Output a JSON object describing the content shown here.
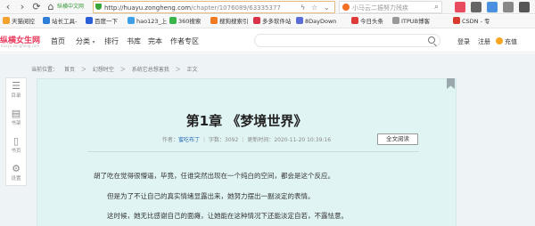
{
  "browser": {
    "bookmark_corner": "纵横中文网",
    "url_host": "http://huayu.zongheng.com",
    "url_path": "/chapter/1076089/63335377",
    "search_placeholder": "小马云二振努力残疾",
    "bookmarks": [
      "天猫阅控",
      "站长工具-",
      "百度一下",
      "hao123_上",
      "360搜索",
      "搜狗搜索引",
      "多多软件站",
      "8DayDown",
      "今日头条",
      "ITPUB博客",
      "CSDN - 专"
    ]
  },
  "header": {
    "logo": "纵横女生网",
    "logo_sub": "huayu.zongheng.com",
    "nav": [
      "首页",
      "分类",
      "排行",
      "书库",
      "完本",
      "作者专区"
    ],
    "nav_dropdown_index": 1,
    "login": "登录",
    "register": "注册",
    "recharge": "充值"
  },
  "breadcrumb": [
    "当前位置：",
    "首页",
    "＞",
    "幻想时空",
    "＞",
    "系统它总想害我",
    "＞",
    "正文"
  ],
  "sidebar": [
    {
      "label": "目录",
      "icon": "list-icon"
    },
    {
      "label": "书架",
      "icon": "bookshelf-icon"
    },
    {
      "label": "书页",
      "icon": "book-page-icon"
    },
    {
      "label": "设置",
      "icon": "gear-icon"
    }
  ],
  "chapter": {
    "title": "第1章 《梦境世界》",
    "author_label": "作者：",
    "author": "蜜吃布丁",
    "wordcount_label": "字数：",
    "wordcount": "3092",
    "updated_label": "更新时间：",
    "updated": "2020-11-20 10:39:16",
    "read_button": "全文阅读",
    "paragraphs": [
      "胡了吃在觉得很懵逼，毕竟，任谁突然出现在一个纯白的空间，都会是这个反应。",
      "但是为了不让自己的真实情绪显露出来，她努力摆出一副淡定的表情。",
      "这时候，她无比感谢自己的面瘫，让她能在这种情况下还能淡定自若，不露怯意。"
    ]
  },
  "colors": {
    "reader_bg": "#e1f4f4",
    "page_bg": "#eef3f6",
    "brand": "#e8385b",
    "author_link": "#2a6db5"
  }
}
